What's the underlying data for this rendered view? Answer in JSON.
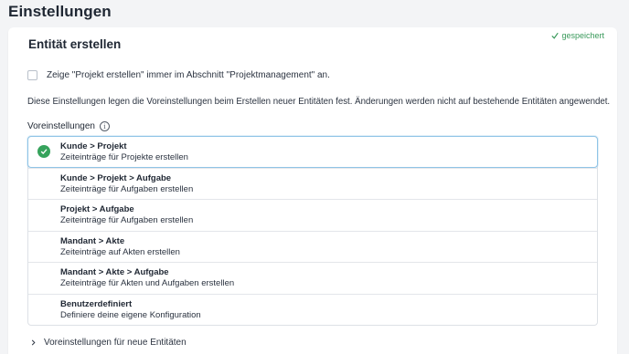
{
  "page": {
    "title": "Einstellungen"
  },
  "card": {
    "saved_label": "gespeichert",
    "title": "Entität erstellen",
    "checkbox_label": "Zeige \"Projekt erstellen\" immer im Abschnitt \"Projektmanagement\" an.",
    "checkbox_checked": false,
    "description": "Diese Einstellungen legen die Voreinstellungen beim Erstellen neuer Entitäten fest. Änderungen werden nicht auf bestehende Entitäten angewendet.",
    "presets_label": "Voreinstellungen",
    "info_glyph": "i",
    "options": [
      {
        "title": "Kunde > Projekt",
        "subtitle": "Zeiteinträge für Projekte erstellen",
        "selected": true
      },
      {
        "title": "Kunde > Projekt > Aufgabe",
        "subtitle": "Zeiteinträge für Aufgaben erstellen",
        "selected": false
      },
      {
        "title": "Projekt > Aufgabe",
        "subtitle": "Zeiteinträge für Aufgaben erstellen",
        "selected": false
      },
      {
        "title": "Mandant > Akte",
        "subtitle": "Zeiteinträge auf Akten erstellen",
        "selected": false
      },
      {
        "title": "Mandant > Akte > Aufgabe",
        "subtitle": "Zeiteinträge für Akten und Aufgaben erstellen",
        "selected": false
      },
      {
        "title": "Benutzerdefiniert",
        "subtitle": "Definiere deine eigene Konfiguration",
        "selected": false
      }
    ],
    "expander_label": "Voreinstellungen für neue Entitäten"
  },
  "colors": {
    "accent_green": "#36a35c",
    "selected_border": "#8fc4e6",
    "background": "#f3f4f6"
  },
  "icons": {
    "saved": "check-icon",
    "selected": "check-circle-icon",
    "info": "info-icon",
    "expander": "chevron-right-icon"
  }
}
